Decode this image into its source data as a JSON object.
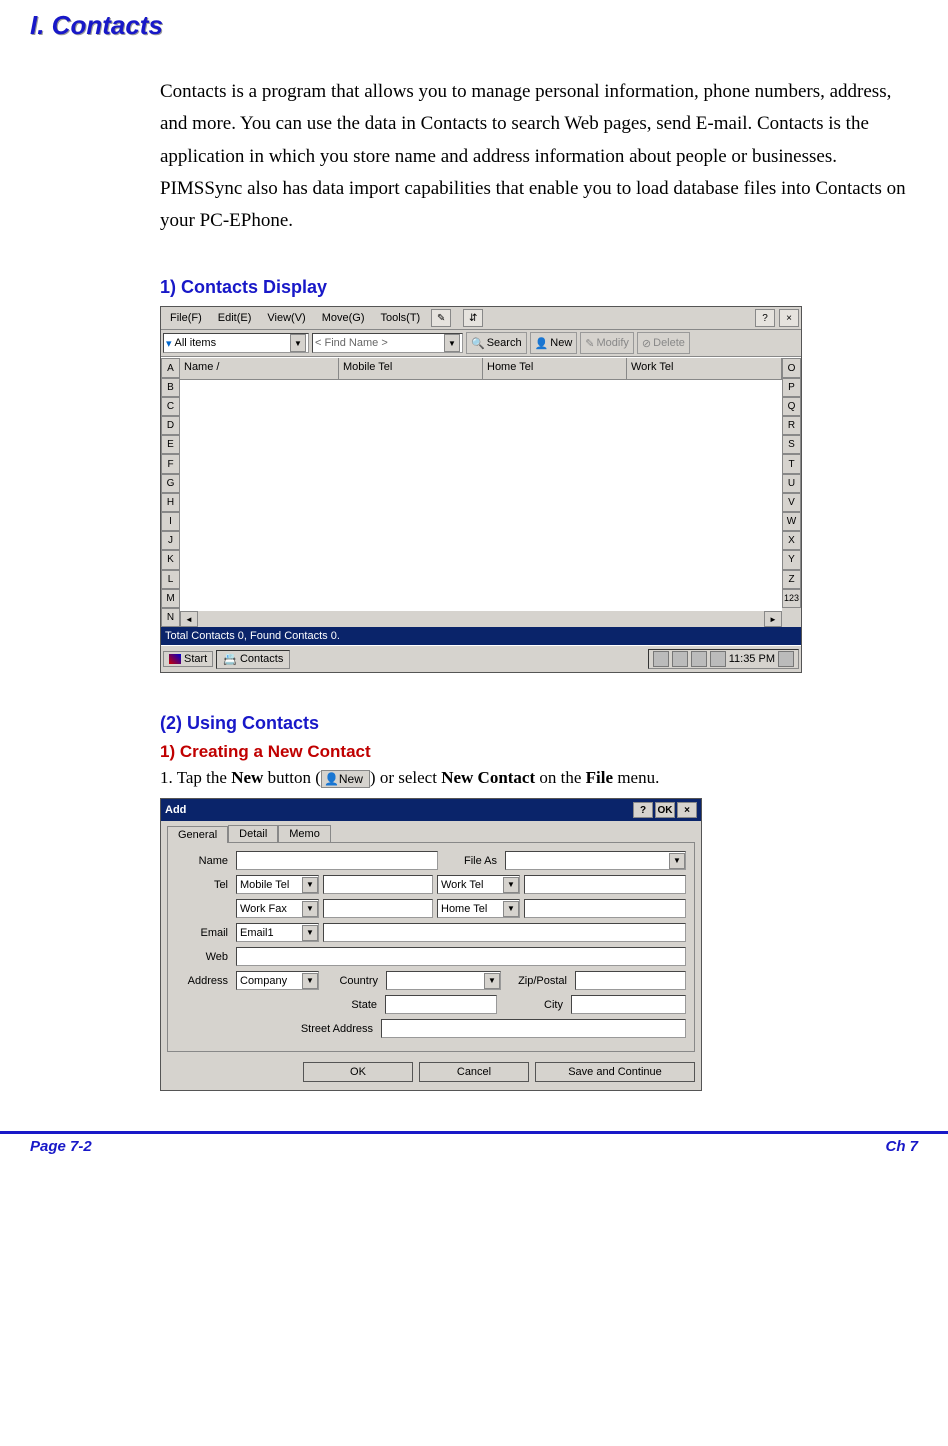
{
  "heading": "I.    Contacts",
  "intro": "Contacts is a program that allows you to manage personal information, phone numbers, address, and more. You can use the data in Contacts to search Web pages, send E-mail. Contacts is the application in which you store name and address information about people or businesses. PIMSSync also has data import capabilities that enable you to load database files into Contacts on your PC-EPhone.",
  "section1": "1)   Contacts Display",
  "section2": "(2)   Using Contacts",
  "section3": "1)   Creating a New Contact",
  "step1_pre": "1.    Tap the ",
  "step1_new": "New",
  "step1_mid": " button (",
  "step1_btn": "New",
  "step1_post": ") or select ",
  "step1_nc": "New Contact",
  "step1_on": " on the ",
  "step1_file": "File",
  "step1_end": " menu.",
  "win1": {
    "menus": [
      "File(F)",
      "Edit(E)",
      "View(V)",
      "Move(G)",
      "Tools(T)"
    ],
    "help": "?",
    "close": "×",
    "filter": "All items",
    "find_placeholder": "< Find Name >",
    "btn_search": "Search",
    "btn_new": "New",
    "btn_modify": "Modify",
    "btn_delete": "Delete",
    "cols": [
      "Name  /",
      "Mobile Tel",
      "Home Tel",
      "Work Tel"
    ],
    "idx_left": [
      "A",
      "B",
      "C",
      "D",
      "E",
      "F",
      "G",
      "H",
      "I",
      "J",
      "K",
      "L",
      "M",
      "N"
    ],
    "idx_right": [
      "O",
      "P",
      "Q",
      "R",
      "S",
      "T",
      "U",
      "V",
      "W",
      "X",
      "Y",
      "Z",
      "123"
    ],
    "status": "Total Contacts  0, Found Contacts 0.",
    "start": "Start",
    "task": "Contacts",
    "time": "11:35 PM"
  },
  "dlg": {
    "title": "Add",
    "help": "?",
    "ok": "OK",
    "close": "×",
    "tabs": [
      "General",
      "Detail",
      "Memo"
    ],
    "lbl_name": "Name",
    "lbl_fileas": "File As",
    "lbl_tel": "Tel",
    "sel_mobile": "Mobile Tel",
    "sel_worktel": "Work Tel",
    "sel_workfax": "Work Fax",
    "sel_hometel": "Home Tel",
    "lbl_email": "Email",
    "sel_email": "Email1",
    "lbl_web": "Web",
    "lbl_addr": "Address",
    "sel_company": "Company",
    "lbl_country": "Country",
    "lbl_zip": "Zip/Postal",
    "lbl_state": "State",
    "lbl_city": "City",
    "lbl_street": "Street Address",
    "btn_ok": "OK",
    "btn_cancel": "Cancel",
    "btn_save": "Save and Continue"
  },
  "footer_left": "Page 7-2",
  "footer_right": "Ch 7"
}
